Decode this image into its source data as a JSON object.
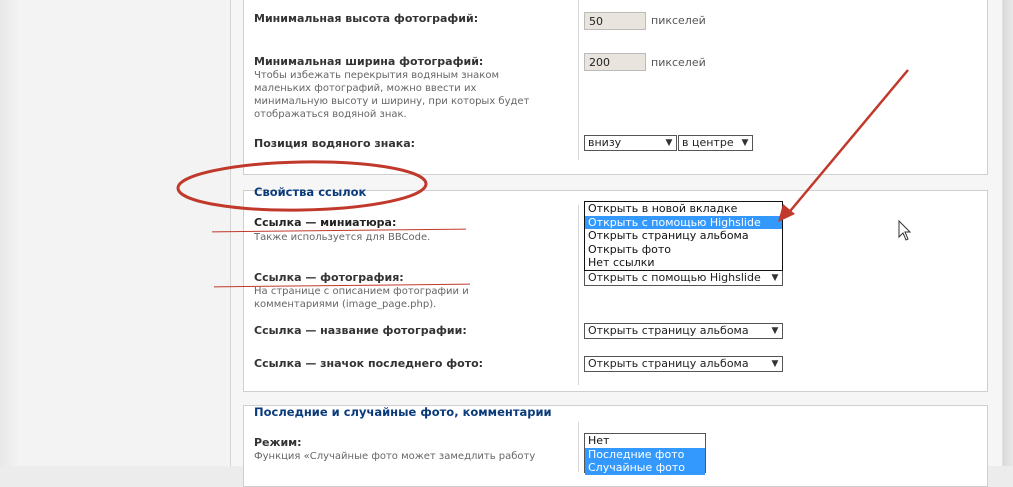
{
  "photo_settings": {
    "min_height_label": "Минимальная высота фотографий:",
    "min_height_value": "50",
    "min_height_unit": "пикселей",
    "min_width_label": "Минимальная ширина фотографий:",
    "min_width_desc": [
      "Чтобы избежать перекрытия водяным знаком",
      "маленьких фотографий, можно ввести их",
      "минимальную высоту и ширину, при которых будет",
      "отображаться водяной знак."
    ],
    "min_width_value": "200",
    "min_width_unit": "пикселей",
    "watermark_pos_label": "Позиция водяного знака:",
    "watermark_vertical": "внизу",
    "watermark_horizontal": "в центре"
  },
  "link_settings": {
    "heading": "Свойства ссылок",
    "thumb_label": "Ссылка — миниатюра:",
    "thumb_desc": "Также используется для BBCode.",
    "thumb_options": [
      "Открыть в новой вкладке",
      "Открыть с помощью Highslide",
      "Открыть страницу альбома",
      "Открыть фото",
      "Нет ссылки"
    ],
    "thumb_selected_index": 1,
    "photo_label": "Ссылка — фотография:",
    "photo_desc": [
      "На странице с описанием фотографии и",
      "комментариями (image_page.php)."
    ],
    "photo_value": "Открыть с помощью Highslide",
    "title_label": "Ссылка — название фотографии:",
    "title_value": "Открыть страницу альбома",
    "last_icon_label": "Ссылка — значок последнего фото:",
    "last_icon_value": "Открыть страницу альбома"
  },
  "recent_settings": {
    "heading": "Последние и случайные фото, комментарии",
    "mode_label": "Режим:",
    "mode_desc": "Функция «Случайные фото может замедлить работу",
    "mode_options": [
      "Нет",
      "Последние фото",
      "Случайные фото"
    ]
  },
  "colors": {
    "heading_blue": "#0a3b7a",
    "selection_blue": "#3399ff",
    "annotation_red": "#c0392b"
  },
  "icons": {
    "dropdown": "chevron-down-icon",
    "cursor": "mouse-pointer-icon"
  }
}
